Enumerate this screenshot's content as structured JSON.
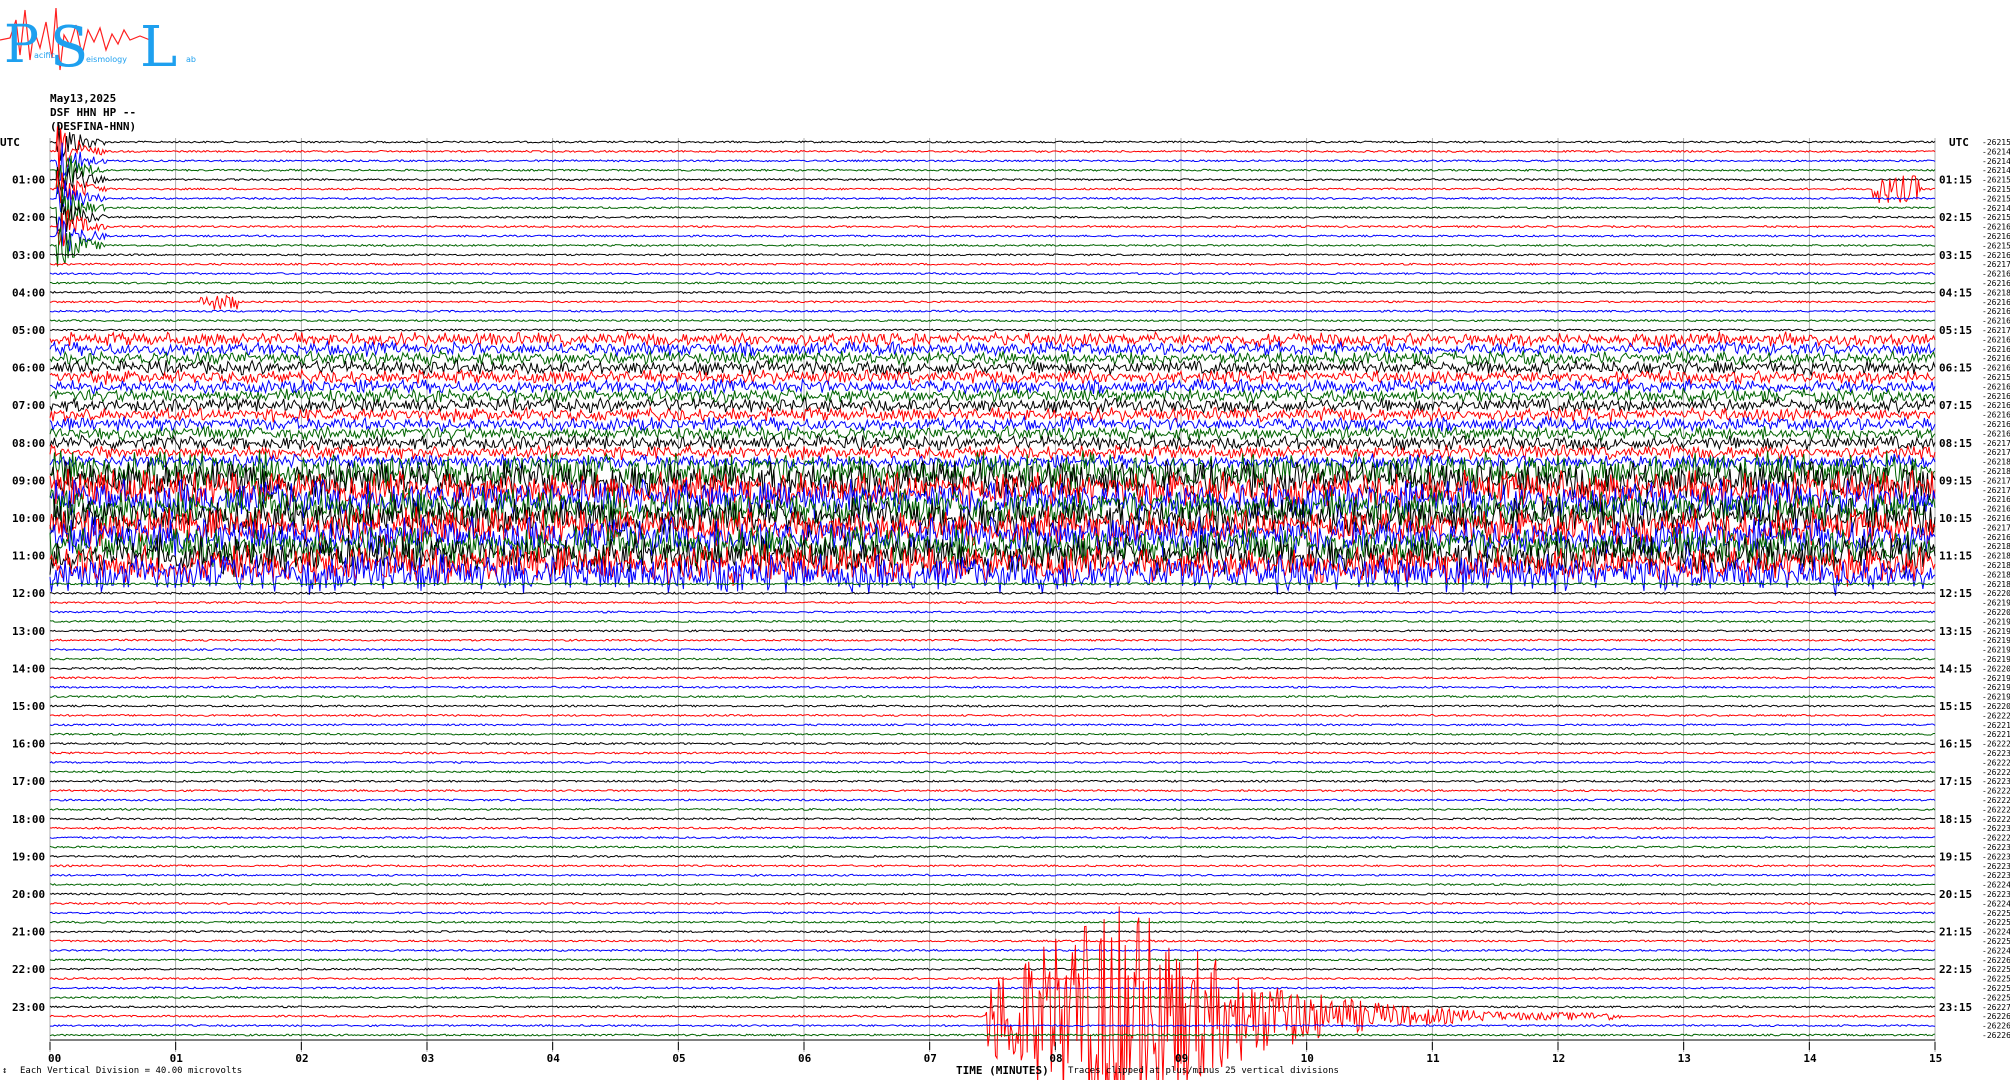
{
  "logo": {
    "letters": [
      "P",
      "S",
      "L"
    ],
    "small_text": [
      "acific",
      "eismology",
      "ab"
    ]
  },
  "header": {
    "date": "May13,2025",
    "channel": "DSF HHN HP --",
    "station": "(DESFINA-HNN)"
  },
  "utc_label_left": "UTC",
  "utc_label_right": "UTC",
  "footer": {
    "scale_note": "Each Vertical Division =   40.00 microvolts",
    "xlabel": "TIME (MINUTES)",
    "trace_note": "Traces clipped at plus/minus 25 vertical divisions"
  },
  "colors": {
    "black": "#000000",
    "red": "#ff0000",
    "blue": "#0000ff",
    "green": "#006400",
    "grid": "#9a9a9a"
  },
  "chart_data": {
    "type": "line",
    "title": "",
    "xlabel": "TIME (MINUTES)",
    "ylabel": "",
    "xlim": [
      0,
      15
    ],
    "x_ticks": [
      "00",
      "01",
      "02",
      "03",
      "04",
      "05",
      "06",
      "07",
      "08",
      "09",
      "10",
      "11",
      "12",
      "13",
      "14",
      "15"
    ],
    "trace_count": 96,
    "trace_color_cycle": [
      "black",
      "red",
      "blue",
      "green"
    ],
    "left_hour_labels": [
      "01:00",
      "02:00",
      "03:00",
      "04:00",
      "05:00",
      "06:00",
      "07:00",
      "08:00",
      "09:00",
      "10:00",
      "11:00",
      "12:00",
      "13:00",
      "14:00",
      "15:00",
      "16:00",
      "17:00",
      "18:00",
      "19:00",
      "20:00",
      "21:00",
      "22:00",
      "23:00"
    ],
    "right_hour_labels": [
      "01:15",
      "02:15",
      "03:15",
      "04:15",
      "05:15",
      "06:15",
      "07:15",
      "08:15",
      "09:15",
      "10:15",
      "11:15",
      "12:15",
      "13:15",
      "14:15",
      "15:15",
      "16:15",
      "17:15",
      "18:15",
      "19:15",
      "20:15",
      "21:15",
      "22:15",
      "23:15"
    ],
    "right_trace_offsets": [
      "-26215",
      "-26214",
      "-26214",
      "-26214",
      "-26215",
      "-26215",
      "-26215",
      "-26214",
      "-26215",
      "-26216",
      "-26216",
      "-26215",
      "-26216",
      "-26217",
      "-26216",
      "-26216",
      "-26218",
      "-26216",
      "-26216",
      "-26216",
      "-26217",
      "-26216",
      "-26216",
      "-26216",
      "-26216",
      "-26215",
      "-26216",
      "-26216",
      "-26216",
      "-26216",
      "-26216",
      "-26216",
      "-26217",
      "-26217",
      "-26218",
      "-26218",
      "-26217",
      "-26217",
      "-26216",
      "-26216",
      "-26216",
      "-26217",
      "-26216",
      "-26218",
      "-26218",
      "-26218",
      "-26218",
      "-26218",
      "-26220",
      "-26219",
      "-26220",
      "-26219",
      "-26219",
      "-26219",
      "-26219",
      "-26219",
      "-26220",
      "-26219",
      "-26219",
      "-26219",
      "-26220",
      "-26222",
      "-26221",
      "-26221",
      "-26222",
      "-26223",
      "-26222",
      "-26222",
      "-26223",
      "-26222",
      "-26222",
      "-26222",
      "-26222",
      "-26223",
      "-26222",
      "-26223",
      "-26223",
      "-26223",
      "-26223",
      "-26224",
      "-26223",
      "-26224",
      "-26225",
      "-26225",
      "-26224",
      "-26225",
      "-26224",
      "-26226",
      "-26225",
      "-26225",
      "-26225",
      "-26225",
      "-26227",
      "-26226",
      "-26226",
      "-26226"
    ],
    "activity": [
      {
        "label": "event near start (hours 00–02)",
        "trace_from": 0,
        "trace_to": 11,
        "minute_from": 0.05,
        "minute_to": 0.45,
        "amplitude": 30
      },
      {
        "label": "small event",
        "trace_from": 5,
        "trace_to": 5,
        "minute_from": 14.5,
        "minute_to": 14.9,
        "amplitude": 14
      },
      {
        "label": "small event",
        "trace_from": 17,
        "trace_to": 17,
        "minute_from": 1.2,
        "minute_to": 1.5,
        "amplitude": 8
      },
      {
        "label": "noise band (hours 05–09)",
        "trace_from": 21,
        "trace_to": 34,
        "minute_from": 0,
        "minute_to": 15,
        "amplitude": 8
      },
      {
        "label": "strong noise band (hours 09–12)",
        "trace_from": 35,
        "trace_to": 46,
        "minute_from": 0,
        "minute_to": 15,
        "amplitude": 22
      },
      {
        "label": "earthquake (hour 23)",
        "trace_from": 93,
        "trace_to": 93,
        "minute_from": 7.45,
        "minute_to": 12.5,
        "amplitude": 120
      }
    ]
  }
}
